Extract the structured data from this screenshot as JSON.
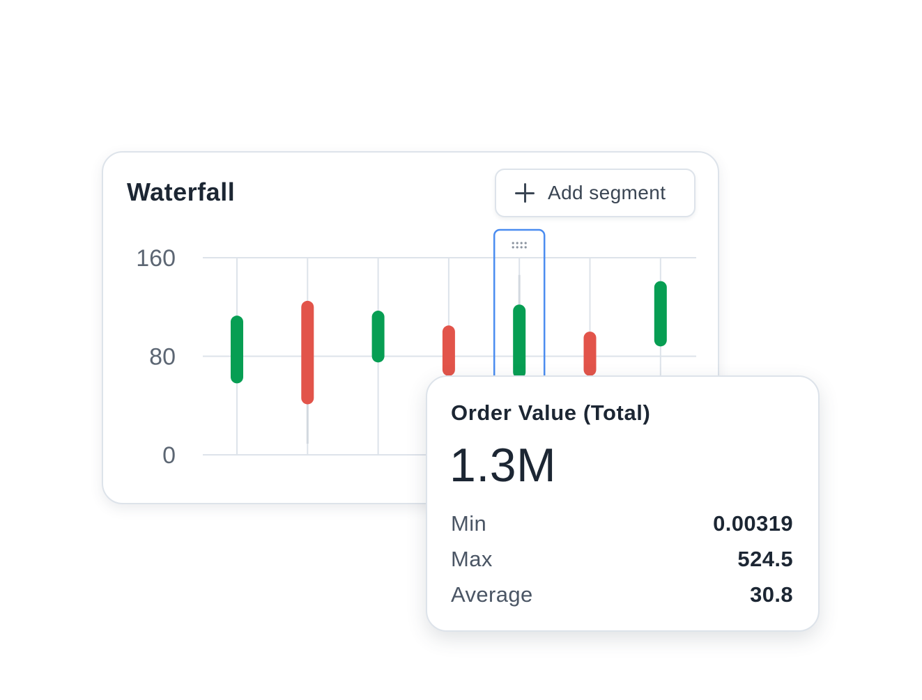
{
  "chart": {
    "title": "Waterfall",
    "add_segment_label": "Add segment",
    "add_icon": "plus-icon",
    "drag_handle_icon": "drag-handle-icon"
  },
  "colors": {
    "increase": "#079e53",
    "decrease": "#e2544a",
    "selection": "#4a8cf0",
    "grid": "#dde3ea"
  },
  "chart_data": {
    "type": "bar",
    "ylim": [
      0,
      160
    ],
    "yticks": [
      0,
      80,
      160
    ],
    "grid": true,
    "selected_index": 4,
    "bars": [
      {
        "low": 58,
        "high": 113,
        "direction": "up"
      },
      {
        "low": 41,
        "high": 125,
        "direction": "down",
        "wick_low": 9
      },
      {
        "low": 75,
        "high": 117,
        "direction": "up"
      },
      {
        "low": 64,
        "high": 105,
        "direction": "down"
      },
      {
        "low": 62,
        "high": 122,
        "direction": "up",
        "wick_high": 146
      },
      {
        "low": 64,
        "high": 100,
        "direction": "down"
      },
      {
        "low": 88,
        "high": 141,
        "direction": "up"
      }
    ]
  },
  "stats": {
    "title": "Order Value (Total)",
    "value": "1.3M",
    "rows": [
      {
        "label": "Min",
        "value": "0.00319"
      },
      {
        "label": "Max",
        "value": "524.5"
      },
      {
        "label": "Average",
        "value": "30.8"
      }
    ]
  }
}
